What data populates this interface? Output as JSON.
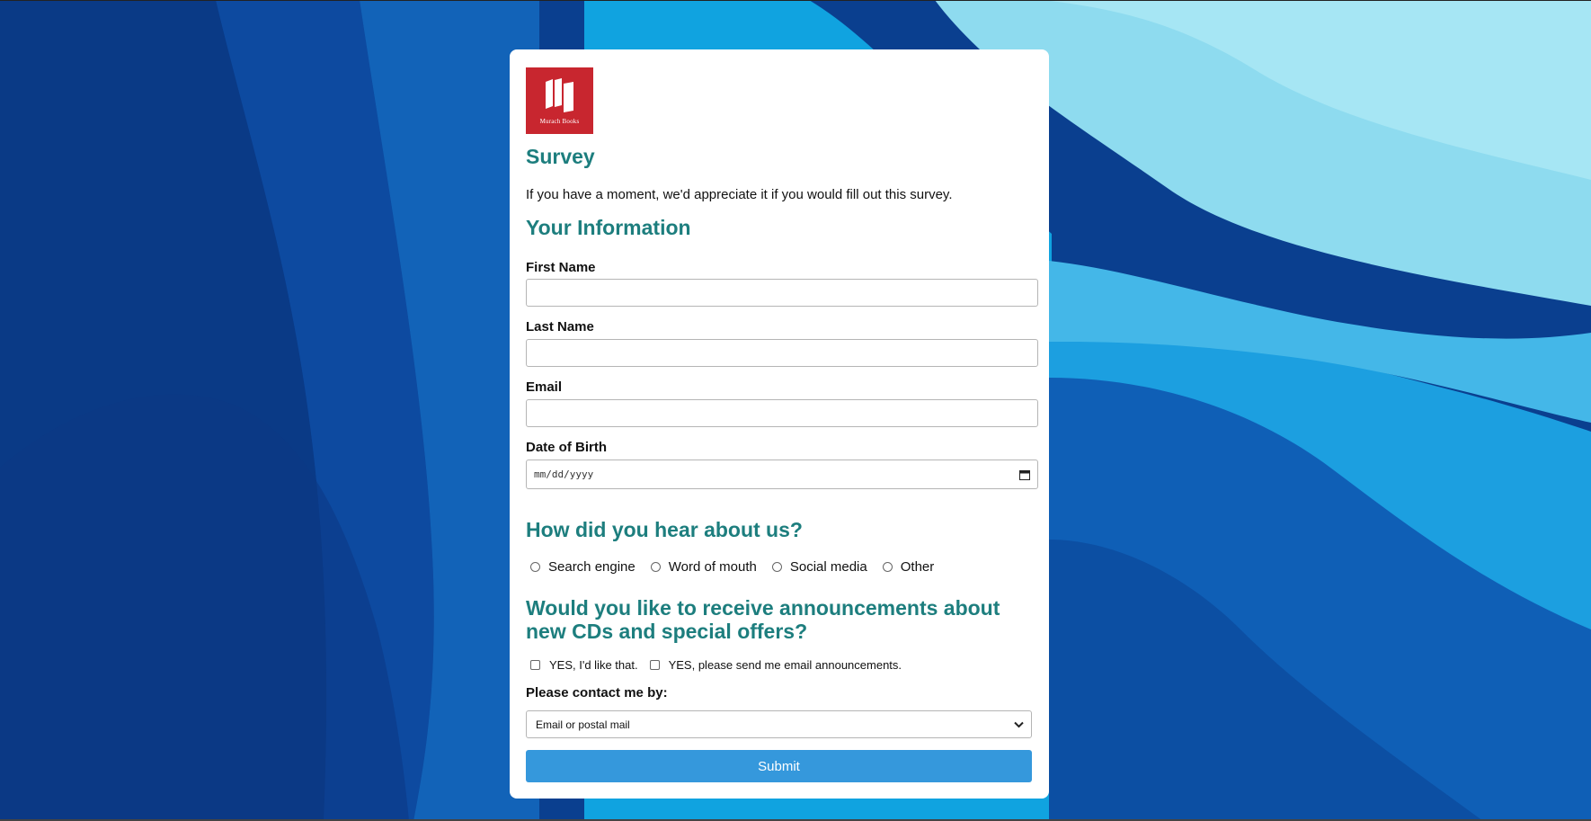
{
  "brand": {
    "logo_text": "Murach Books",
    "logo_color": "#c8262f"
  },
  "colors": {
    "heading": "#1d7e7e",
    "button": "#3598dc"
  },
  "survey": {
    "title": "Survey",
    "intro": "If you have a moment, we'd appreciate it if you would fill out this survey."
  },
  "info": {
    "heading": "Your Information",
    "first_name_label": "First Name",
    "first_name_value": "",
    "last_name_label": "Last Name",
    "last_name_value": "",
    "email_label": "Email",
    "email_value": "",
    "dob_label": "Date of Birth",
    "dob_placeholder": "mm/dd/yyyy"
  },
  "heard": {
    "heading": "How did you hear about us?",
    "options": [
      "Search engine",
      "Word of mouth",
      "Social media",
      "Other"
    ]
  },
  "announce": {
    "heading_line1": "Would you like to receive announcements about",
    "heading_line2": "new CDs and special offers?",
    "options": [
      "YES, I'd like that.",
      "YES, please send me email announcements."
    ]
  },
  "contact": {
    "label": "Please contact me by:",
    "selected": "Email or postal mail"
  },
  "submit_label": "Submit"
}
